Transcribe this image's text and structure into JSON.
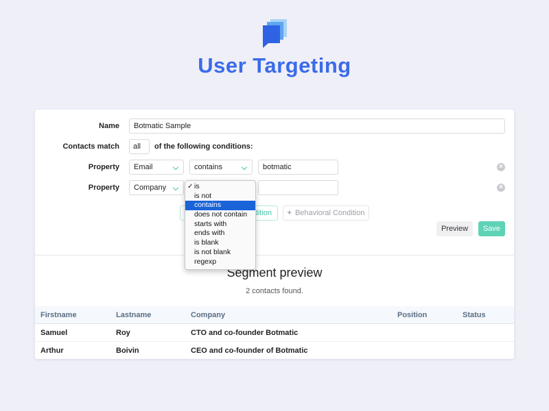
{
  "header": {
    "title": "User Targeting",
    "logo_icon": "chat-stack-icon",
    "accent_color": "#3b6bea"
  },
  "form": {
    "name_label": "Name",
    "name_value": "Botmatic Sample",
    "match_label": "Contacts match",
    "match_value": "all",
    "match_suffix": "of the following conditions:",
    "conditions": [
      {
        "label": "Property",
        "property": "Email",
        "operator": "contains",
        "value": "botmatic"
      },
      {
        "label": "Property",
        "property": "Company",
        "operator": "contains",
        "value": ""
      }
    ],
    "add_property_label": "dition",
    "add_behavioral_label": "Behavioral Condition",
    "add_behavioral_icon": "+",
    "preview_label": "Preview",
    "save_label": "Save"
  },
  "operator_dropdown": {
    "selected": "contains",
    "checked": "is",
    "options": [
      "is",
      "is not",
      "contains",
      "does not contain",
      "starts with",
      "ends with",
      "is blank",
      "is not blank",
      "regexp"
    ]
  },
  "segment_preview": {
    "title": "Segment preview",
    "count_text": "2 contacts found.",
    "columns": [
      "Firstname",
      "Lastname",
      "Company",
      "Position",
      "Status"
    ],
    "rows": [
      {
        "firstname": "Samuel",
        "lastname": "Roy",
        "company": "CTO and co-founder Botmatic",
        "position": "",
        "status": ""
      },
      {
        "firstname": "Arthur",
        "lastname": "Boivin",
        "company": "CEO and co-founder of Botmatic",
        "position": "",
        "status": ""
      }
    ]
  },
  "colors": {
    "background": "#efeff8",
    "teal": "#48c2a8",
    "save_button": "#5fd3b5",
    "highlight": "#1a63d8"
  }
}
